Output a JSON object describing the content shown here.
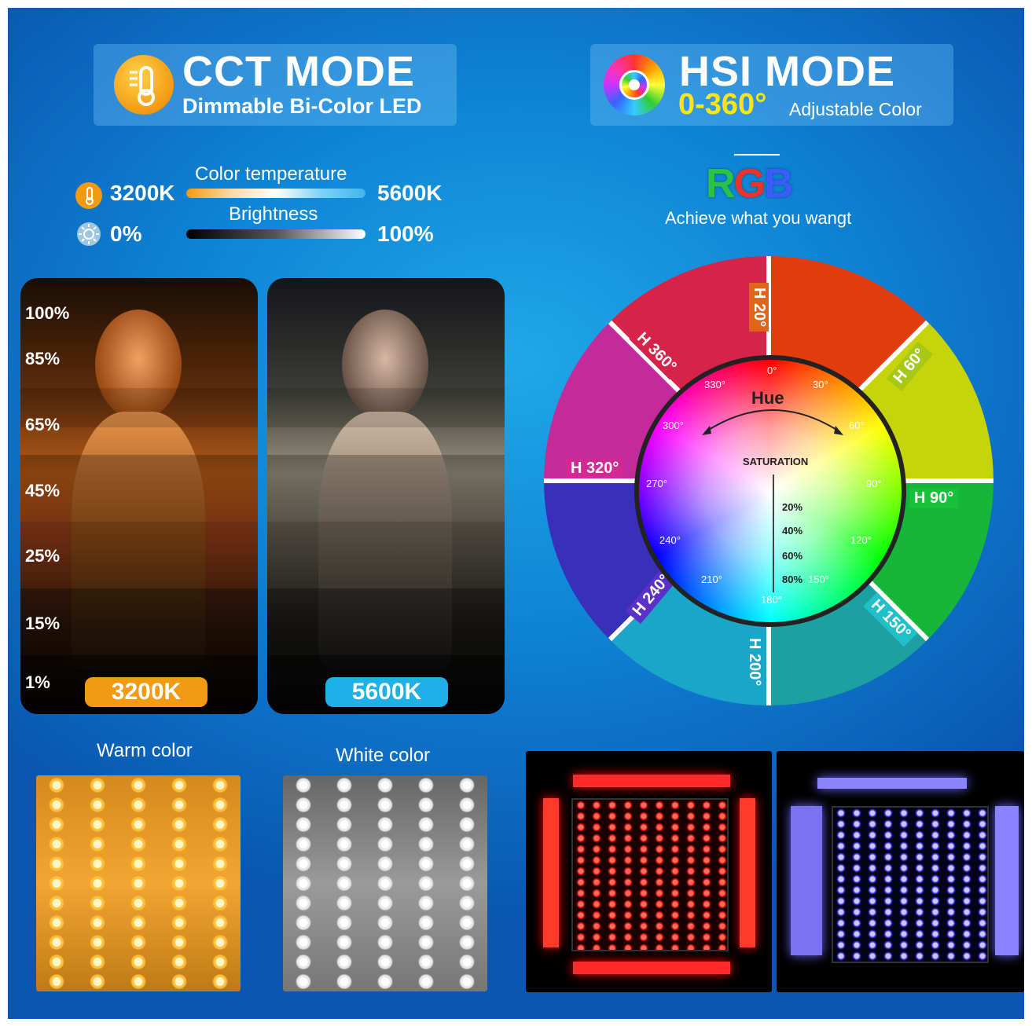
{
  "cct": {
    "title": "CCT MODE",
    "subtitle": "Dimmable Bi-Color LED"
  },
  "hsi": {
    "title": "HSI MODE",
    "range": "0-360°",
    "subtitle": "Adjustable Color"
  },
  "sliders": {
    "temp_label": "Color temperature",
    "temp_min": "3200K",
    "temp_max": "5600K",
    "bright_label": "Brightness",
    "bright_min": "0%",
    "bright_max": "100%"
  },
  "rgb": {
    "logo": "RGB",
    "tagline": "Achieve what you wangt"
  },
  "brightness_levels": [
    "100%",
    "85%",
    "65%",
    "45%",
    "25%",
    "15%",
    "1%"
  ],
  "photos": {
    "warm_badge": "3200K",
    "cool_badge": "5600K"
  },
  "led_captions": {
    "warm": "Warm color",
    "white": "White color"
  },
  "wheel": {
    "hue_title": "Hue",
    "saturation_title": "SATURATION",
    "hue_degrees": [
      "0°",
      "30°",
      "60°",
      "90°",
      "120°",
      "150°",
      "180°",
      "210°",
      "240°",
      "270°",
      "300°",
      "330°"
    ],
    "saturation_levels": [
      "20%",
      "40%",
      "60%",
      "80%"
    ],
    "segments": [
      "H 20°",
      "H 60°",
      "H 90°",
      "H 150°",
      "H 200°",
      "H 240°",
      "H 320°",
      "H 360°"
    ]
  },
  "colors": {
    "accent_orange": "#f29a12",
    "accent_cyan": "#1fb0e8",
    "hsi_yellow": "#ffe516"
  }
}
